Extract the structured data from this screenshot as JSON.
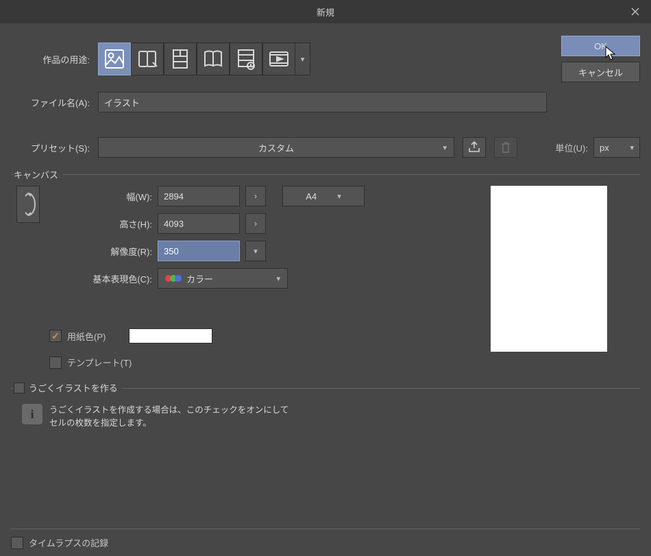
{
  "window": {
    "title": "新規"
  },
  "buttons": {
    "ok": "OK",
    "cancel": "キャンセル"
  },
  "purpose": {
    "label": "作品の用途:"
  },
  "file": {
    "label": "ファイル名(A):",
    "value": "イラスト"
  },
  "preset": {
    "label": "プリセット(S):",
    "value": "カスタム",
    "unit_label": "単位(U):",
    "unit_value": "px"
  },
  "canvas": {
    "legend": "キャンバス",
    "width_label": "幅(W):",
    "width_value": "2894",
    "height_label": "高さ(H):",
    "height_value": "4093",
    "resolution_label": "解像度(R):",
    "resolution_value": "350",
    "colormode_label": "基本表現色(C):",
    "colormode_value": "カラー",
    "size_preset": "A4",
    "paper_color_label": "用紙色(P)",
    "template_label": "テンプレート(T)"
  },
  "moving": {
    "legend": "うごくイラストを作る",
    "info": "うごくイラストを作成する場合は、このチェックをオンにして\nセルの枚数を指定します。"
  },
  "timelapse": {
    "label": "タイムラプスの記録"
  }
}
